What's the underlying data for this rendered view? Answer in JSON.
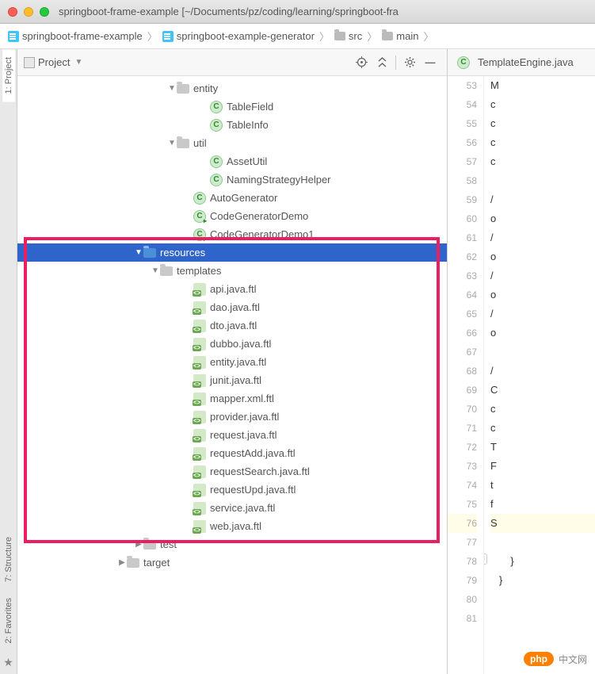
{
  "window": {
    "title": "springboot-frame-example [~/Documents/pz/coding/learning/springboot-fra"
  },
  "breadcrumbs": [
    {
      "label": "springboot-frame-example",
      "icon": "module"
    },
    {
      "label": "springboot-example-generator",
      "icon": "module"
    },
    {
      "label": "src",
      "icon": "folder"
    },
    {
      "label": "main",
      "icon": "folder"
    }
  ],
  "toolTabs": {
    "project": "1: Project",
    "structure": "7: Structure",
    "favorites": "2: Favorites"
  },
  "projectHeader": {
    "label": "Project"
  },
  "tree": {
    "entity": {
      "label": "entity",
      "children": [
        {
          "label": "TableField",
          "type": "class"
        },
        {
          "label": "TableInfo",
          "type": "class"
        }
      ]
    },
    "util": {
      "label": "util",
      "children": [
        {
          "label": "AssetUtil",
          "type": "class"
        },
        {
          "label": "NamingStrategyHelper",
          "type": "class"
        }
      ]
    },
    "topClasses": [
      {
        "label": "AutoGenerator",
        "runnable": false
      },
      {
        "label": "CodeGeneratorDemo",
        "runnable": true
      },
      {
        "label": "CodeGeneratorDemo1",
        "runnable": true
      }
    ],
    "resources": {
      "label": "resources"
    },
    "templates": {
      "label": "templates",
      "files": [
        "api.java.ftl",
        "dao.java.ftl",
        "dto.java.ftl",
        "dubbo.java.ftl",
        "entity.java.ftl",
        "junit.java.ftl",
        "mapper.xml.ftl",
        "provider.java.ftl",
        "request.java.ftl",
        "requestAdd.java.ftl",
        "requestSearch.java.ftl",
        "requestUpd.java.ftl",
        "service.java.ftl",
        "web.java.ftl"
      ]
    },
    "test": {
      "label": "test"
    },
    "target": {
      "label": "target"
    }
  },
  "editor": {
    "tab": "TemplateEngine.java",
    "startLine": 53,
    "endLine": 81,
    "currentLine": 76,
    "code": [
      "M",
      "c",
      "c",
      "c",
      "c",
      "",
      "/",
      "o",
      "/",
      "o",
      "/",
      "o",
      "/",
      "o",
      "",
      "/",
      "C",
      "c",
      "c",
      "T",
      "F",
      "t",
      "f",
      "S",
      "",
      "       }",
      "   }",
      "",
      ""
    ]
  },
  "watermark": {
    "badge": "php",
    "text": "中文网"
  }
}
